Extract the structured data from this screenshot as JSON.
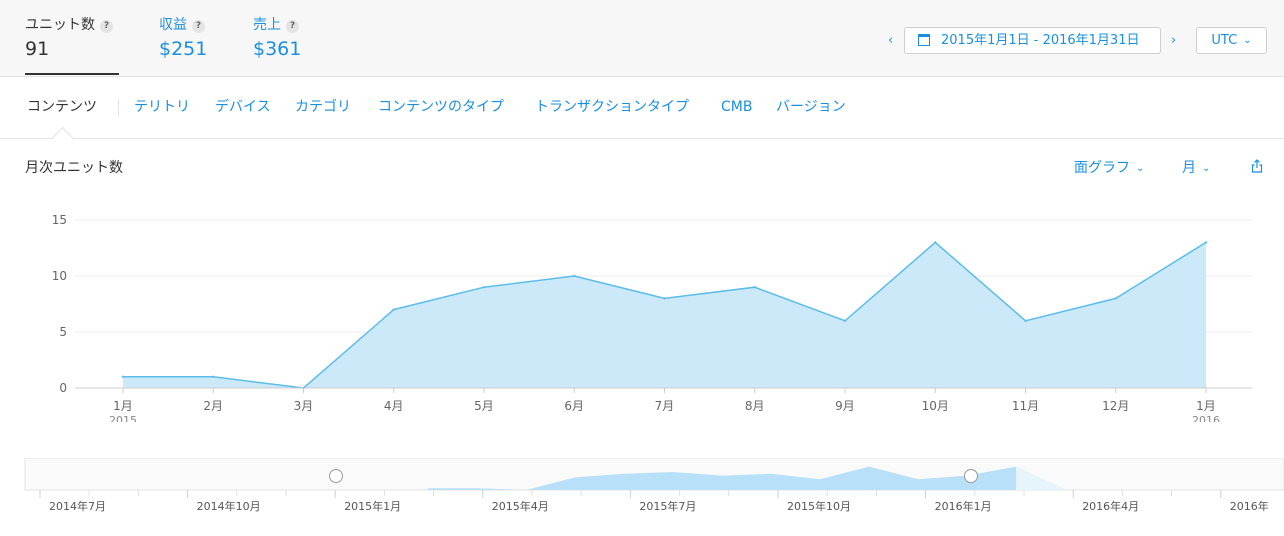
{
  "summary": {
    "units": {
      "label": "ユニット数",
      "value": "91",
      "help": "?"
    },
    "proceeds": {
      "label": "収益",
      "value": "$251",
      "help": "?"
    },
    "sales": {
      "label": "売上",
      "value": "$361",
      "help": "?"
    }
  },
  "date_range": {
    "prev": "‹",
    "next": "›",
    "label": "2015年1月1日 - 2016年1月31日",
    "icon": "calendar-icon"
  },
  "timezone": {
    "label": "UTC",
    "icon": "chevron-down-icon"
  },
  "tabs": [
    {
      "label": "コンテンツ",
      "active": true
    },
    {
      "label": "テリトリ"
    },
    {
      "label": "デバイス"
    },
    {
      "label": "カテゴリ"
    },
    {
      "label": "コンテンツのタイプ"
    },
    {
      "label": "トランザクションタイプ"
    },
    {
      "label": "CMB"
    },
    {
      "label": "バージョン"
    }
  ],
  "chart_header": {
    "title": "月次ユニット数",
    "chart_type_label": "面グラフ",
    "interval_label": "月",
    "share_icon": "share-icon"
  },
  "colors": {
    "accent": "#1a8fe0",
    "area_fill": "#cce9fa",
    "area_line": "#5bbde8",
    "grid": "#ececec"
  },
  "chart_data": {
    "type": "area",
    "title": "",
    "xlabel": "",
    "ylabel": "",
    "categories": [
      "1月\n2015",
      "2月",
      "3月",
      "4月",
      "5月",
      "6月",
      "7月",
      "8月",
      "9月",
      "10月",
      "11月",
      "12月",
      "1月\n2016"
    ],
    "values": [
      1,
      1,
      0,
      7,
      9,
      10,
      8,
      9,
      6,
      13,
      6,
      8,
      13
    ],
    "ylim": [
      0,
      15
    ],
    "yticks": [
      0,
      5,
      10,
      15
    ],
    "grid": true,
    "legend": "none"
  },
  "overview": {
    "labels": [
      "2014年7月",
      "2014年10月",
      "2015年1月",
      "2015年4月",
      "2015年7月",
      "2015年10月",
      "2016年1月",
      "2016年4月",
      "2016年"
    ],
    "selection": "2015年1月 - 2016年1月"
  }
}
